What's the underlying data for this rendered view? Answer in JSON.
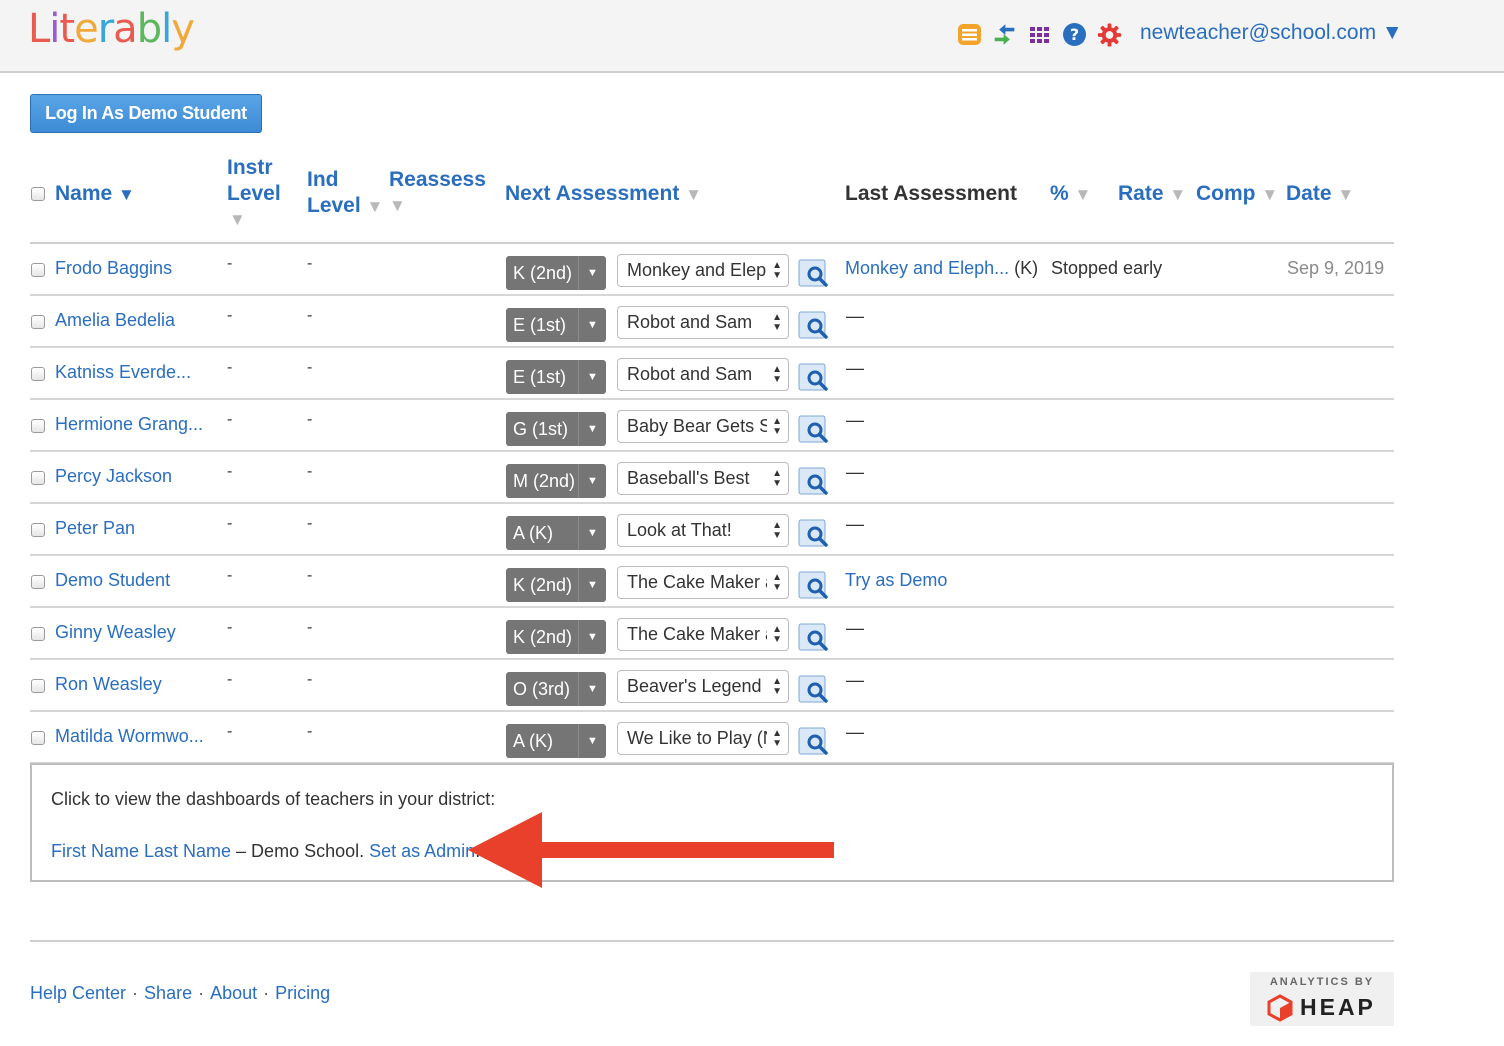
{
  "header": {
    "logo_text": "Literably",
    "logo_letters": [
      {
        "ch": "L",
        "color": "#e95b4e"
      },
      {
        "ch": "i",
        "color": "#9a5bd3"
      },
      {
        "ch": "t",
        "color": "#e95b4e"
      },
      {
        "ch": "e",
        "color": "#f0a93b"
      },
      {
        "ch": "r",
        "color": "#37a6d9"
      },
      {
        "ch": "a",
        "color": "#e95b4e"
      },
      {
        "ch": "b",
        "color": "#5bb85d"
      },
      {
        "ch": "l",
        "color": "#37a6d9"
      },
      {
        "ch": "y",
        "color": "#f0a93b"
      }
    ],
    "icons": [
      "list-icon",
      "sync-icon",
      "grid-icon",
      "help-icon",
      "settings-icon"
    ],
    "account_label": "newteacher@school.com ▼"
  },
  "demo_button": {
    "label": "Log In As Demo Student"
  },
  "columns": {
    "name": "Name",
    "name_sort": "▼",
    "instr_1": "Instr",
    "instr_2": "Level",
    "ind_1": "Ind",
    "ind_2": "Level",
    "reassess": "Reassess",
    "next": "Next Assessment",
    "last": "Last Assessment",
    "pct": "%",
    "rate": "Rate",
    "comp": "Comp",
    "date": "Date",
    "sort_arrow": "▼"
  },
  "rows": [
    {
      "name": "Frodo Baggins",
      "instr": "-",
      "ind": "-",
      "level": "K (2nd)",
      "book": "Monkey and Elephant",
      "last_link": "Monkey and Eleph...",
      "last_grade": " (K)",
      "status": "Stopped early",
      "date": "Sep 9, 2019"
    },
    {
      "name": "Amelia Bedelia",
      "instr": "-",
      "ind": "-",
      "level": "E (1st)",
      "book": "Robot and Sam",
      "last_dash": "—"
    },
    {
      "name": "Katniss Everde...",
      "instr": "-",
      "ind": "-",
      "level": "E (1st)",
      "book": "Robot and Sam",
      "last_dash": "—"
    },
    {
      "name": "Hermione Grang...",
      "instr": "-",
      "ind": "-",
      "level": "G (1st)",
      "book": "Baby Bear Gets Stuck",
      "last_dash": "—"
    },
    {
      "name": "Percy Jackson",
      "instr": "-",
      "ind": "-",
      "level": "M (2nd)",
      "book": "Baseball's Best",
      "last_dash": "—"
    },
    {
      "name": "Peter Pan",
      "instr": "-",
      "ind": "-",
      "level": "A (K)",
      "book": "Look at That!",
      "last_dash": "—"
    },
    {
      "name": "Demo Student",
      "instr": "-",
      "ind": "-",
      "level": "K (2nd)",
      "book": "The Cake Maker and",
      "last_link": "Try as Demo"
    },
    {
      "name": "Ginny Weasley",
      "instr": "-",
      "ind": "-",
      "level": "K (2nd)",
      "book": "The Cake Maker and",
      "last_dash": "—"
    },
    {
      "name": "Ron Weasley",
      "instr": "-",
      "ind": "-",
      "level": "O (3rd)",
      "book": "Beaver's Legend",
      "last_dash": "—"
    },
    {
      "name": "Matilda Wormwo...",
      "instr": "-",
      "ind": "-",
      "level": "A (K)",
      "book": "We Like to Play (N",
      "last_dash": "—"
    }
  ],
  "district": {
    "intro": "Click to view the dashboards of teachers in your district:",
    "teacher_link": "First Name Last Name",
    "school_text": " – Demo School. ",
    "admin_link": "Set as Admin",
    "period": "."
  },
  "annotation": {
    "arrow_color": "#e8402a"
  },
  "footer": {
    "links": [
      "Help Center",
      "Share",
      "About",
      "Pricing"
    ],
    "separator": "·"
  },
  "heap_badge": {
    "by": "ANALYTICS BY",
    "brand": "HEAP"
  }
}
